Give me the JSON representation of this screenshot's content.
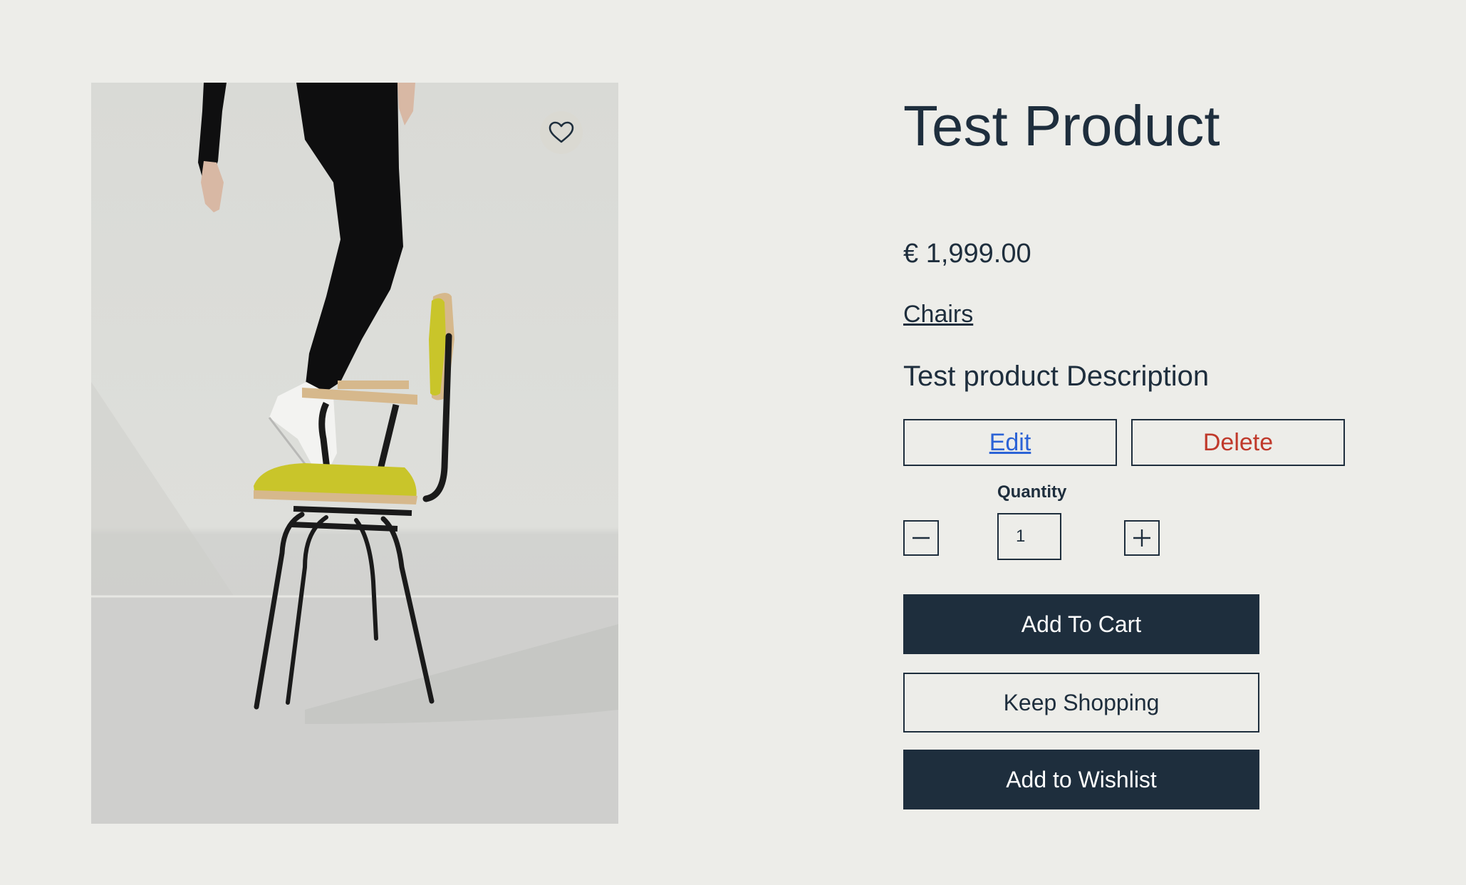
{
  "product": {
    "title": "Test Product",
    "price": "€ 1,999.00",
    "category": "Chairs",
    "description": "Test product Description",
    "image_alt": "Person standing on a chair with yellow seat"
  },
  "admin": {
    "edit_label": "Edit",
    "delete_label": "Delete"
  },
  "quantity": {
    "label": "Quantity",
    "value": "1"
  },
  "actions": {
    "add_to_cart": "Add To Cart",
    "keep_shopping": "Keep Shopping",
    "add_to_wishlist": "Add to Wishlist"
  },
  "icons": {
    "wishlist": "heart-icon",
    "decrement": "minus-icon",
    "increment": "plus-icon"
  },
  "colors": {
    "page_background": "#EDEDE9",
    "primary": "#1E2E3D",
    "link": "#2C63D6",
    "danger": "#C0392B",
    "seat_yellow": "#C9C52A"
  }
}
